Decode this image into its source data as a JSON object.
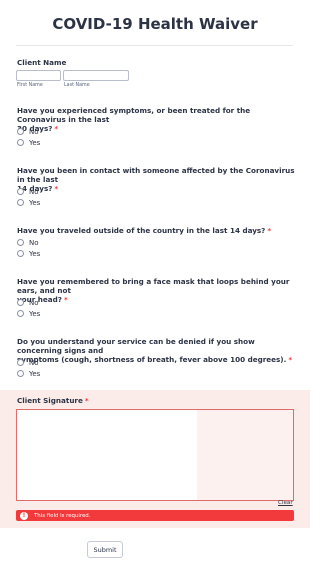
{
  "form": {
    "title": "COVID-19 Health Waiver"
  },
  "client_name": {
    "label": "Client Name",
    "first_sublabel": "First Name",
    "last_sublabel": "Last Name",
    "first_value": "",
    "last_value": ""
  },
  "questions": [
    {
      "line1": "Have you experienced symptoms, or been treated for the Coronavirus in the last",
      "line2": "30 days?",
      "required": "*",
      "options": [
        "No",
        "Yes"
      ]
    },
    {
      "line1": "Have you been in contact with someone affected by the Coronavirus in the last",
      "line2": "14 days?",
      "required": "*",
      "options": [
        "No",
        "Yes"
      ]
    },
    {
      "line1": "Have you traveled outside of the country in the last 14 days?",
      "line2": "",
      "required": "*",
      "options": [
        "No",
        "Yes"
      ]
    },
    {
      "line1": "Have you remembered to bring a face mask that loops behind your ears, and not",
      "line2": "your head?",
      "required": "*",
      "options": [
        "No",
        "Yes"
      ]
    },
    {
      "line1": "Do you understand your service can be denied if you show concerning signs and",
      "line2": "symptoms (cough, shortness of breath, fever above 100 degrees).",
      "required": "*",
      "options": [
        "No",
        "Yes"
      ]
    }
  ],
  "signature": {
    "label": "Client Signature",
    "required": "*",
    "clear_label": "Clear",
    "error_text": "This field is required.",
    "error_icon": "!"
  },
  "submit_label": "Submit",
  "colors": {
    "error": "#f23a3c",
    "error_bg": "#fbecea"
  }
}
